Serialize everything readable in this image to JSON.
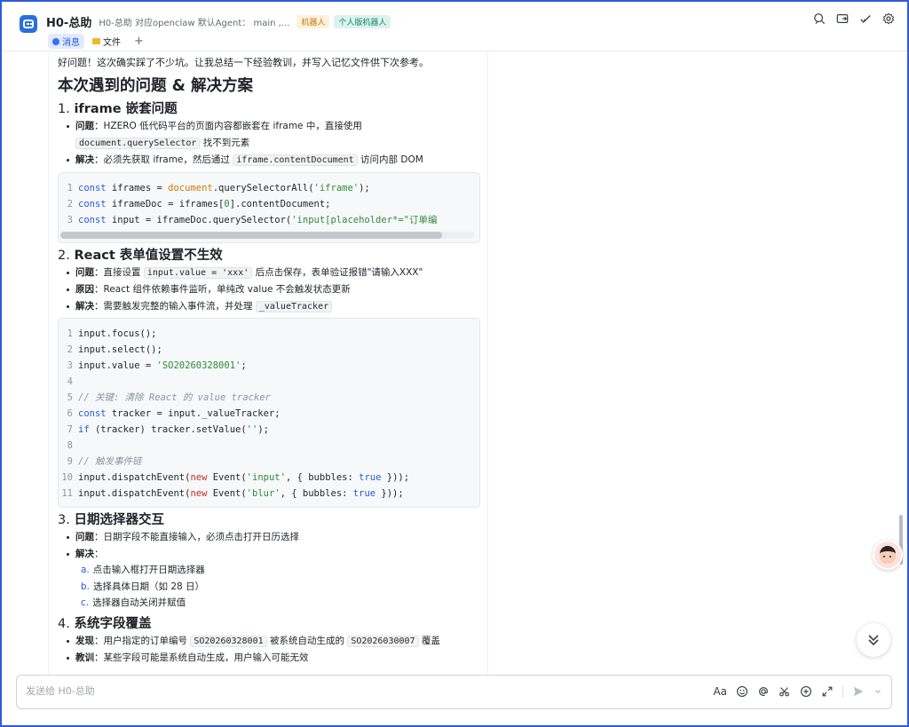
{
  "header": {
    "title": "H0-总助",
    "description": "H0-总助 对应openclaw 默认Agent： main ,...",
    "badges": [
      "机器人",
      "个人版机器人"
    ],
    "tabs": [
      {
        "label": "消息",
        "active": true
      },
      {
        "label": "文件",
        "active": false
      }
    ],
    "tab_add": "+"
  },
  "message": {
    "intro": "好问题！这次确实踩了不少坑。让我总结一下经验教训，并写入记忆文件供下次参考。",
    "heading": "本次遇到的问题 & 解决方案",
    "sections": [
      {
        "number": "1.",
        "title": "iframe 嵌套问题",
        "bullets": [
          {
            "key": "问题",
            "text_a": "：HZERO 低代码平台的页面内容都嵌套在 iframe 中，直接使用",
            "code_a": "document.querySelector",
            "text_b": "找不到元素"
          },
          {
            "key": "解决",
            "text_a": "：必须先获取 iframe，然后通过",
            "code_a": "iframe.contentDocument",
            "text_b": "访问内部 DOM"
          }
        ],
        "code": [
          "const iframes = document.querySelectorAll('iframe');",
          "const iframeDoc = iframes[0].contentDocument;",
          "const input = iframeDoc.querySelector('input[placeholder*=\"订单编"
        ]
      },
      {
        "number": "2.",
        "title": "React 表单值设置不生效",
        "bullets": [
          {
            "key": "问题",
            "text_a": "：直接设置",
            "code_a": "input.value = 'xxx'",
            "text_b": "后点击保存，表单验证报错\"请输入XXX\""
          },
          {
            "key": "原因",
            "text_a": "：React 组件依赖事件监听，单纯改 value 不会触发状态更新",
            "code_a": "",
            "text_b": ""
          },
          {
            "key": "解决",
            "text_a": "：需要触发完整的输入事件流，并处理",
            "code_a": "_valueTracker",
            "text_b": ""
          }
        ],
        "code": [
          "input.focus();",
          "input.select();",
          "input.value = 'SO20260328001';",
          "",
          "// 关键: 清除 React 的 value tracker",
          "const tracker = input._valueTracker;",
          "if (tracker) tracker.setValue('');",
          "",
          "// 触发事件链",
          "input.dispatchEvent(new Event('input', { bubbles: true }));",
          "input.dispatchEvent(new Event('blur', { bubbles: true }));"
        ]
      },
      {
        "number": "3.",
        "title": "日期选择器交互",
        "bullets": [
          {
            "key": "问题",
            "text_a": "：日期字段不能直接输入，必须点击打开日历选择",
            "code_a": "",
            "text_b": ""
          },
          {
            "key": "解决",
            "text_a": "：",
            "code_a": "",
            "text_b": ""
          }
        ],
        "steps": [
          {
            "letter": "a.",
            "text": "点击输入框打开日期选择器"
          },
          {
            "letter": "b.",
            "text": "选择具体日期（如 28 日）"
          },
          {
            "letter": "c.",
            "text": "选择器自动关闭并赋值"
          }
        ]
      },
      {
        "number": "4.",
        "title": "系统字段覆盖",
        "bullets": [
          {
            "key": "发现",
            "text_a": "：用户指定的订单编号",
            "code_a": "SO20260328001",
            "text_b": "被系统自动生成的",
            "code_b": "SO2026030007",
            "text_c": "覆盖"
          },
          {
            "key": "教训",
            "text_a": "：某些字段可能是系统自动生成，用户输入可能无效",
            "code_a": "",
            "text_b": ""
          }
        ]
      }
    ]
  },
  "composer": {
    "placeholder": "发送给 H0-总助",
    "format_label": "Aa"
  },
  "colors": {
    "accent": "#3370ff",
    "frame": "#2f5bd9",
    "badge_bot_bg": "#fdf0dc",
    "badge_personal_bg": "#dcf3ec"
  },
  "icons": [
    "search-icon",
    "share-icon",
    "task-check-icon",
    "settings-icon",
    "emoji-icon",
    "mention-icon",
    "scissors-icon",
    "add-circle-icon",
    "expand-icon",
    "send-icon",
    "chevron-down-icon",
    "scroll-down-icon"
  ]
}
